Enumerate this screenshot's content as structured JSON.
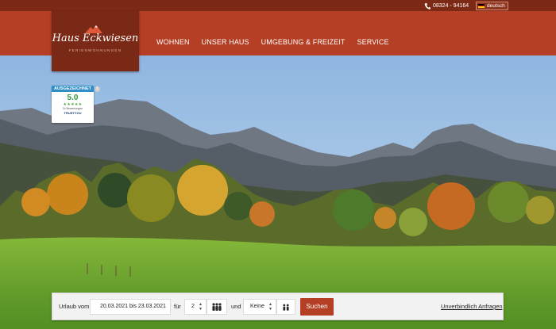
{
  "topbar": {
    "phone": "08324 - 94164",
    "phone_icon": "phone-icon",
    "language": "deutsch",
    "language_icon": "german-flag-icon"
  },
  "logo": {
    "title": "Haus Eckwiesen",
    "subtitle": "FERIENWOHNUNGEN",
    "icon": "mountain-logo-icon"
  },
  "nav": {
    "items": [
      {
        "label": "WOHNEN"
      },
      {
        "label": "UNSER HAUS"
      },
      {
        "label": "UMGEBUNG & FREIZEIT"
      },
      {
        "label": "SERVICE"
      }
    ]
  },
  "badge": {
    "header": "AUSGEZEICHNET",
    "score": "5.0",
    "stars": "★★★★★",
    "reviews": "34 Bewertungen",
    "brand": "TRUSTYOU",
    "info": "i"
  },
  "booking": {
    "vacation_label": "Urlaub vom",
    "date_range": "20.03.2021 bis 23.03.2021",
    "for_label": "für",
    "adults_value": "2",
    "and_label": "und",
    "children_value": "Keine",
    "search_label": "Suchen",
    "inquiry_label": "Unverbindlich Anfragen"
  },
  "colors": {
    "topbar": "#7c2a16",
    "navbar": "#b53f24",
    "logo_bg": "#7a2916",
    "accent": "#b53f24",
    "sky": "#a6c8e8",
    "meadow": "#6fa531"
  }
}
